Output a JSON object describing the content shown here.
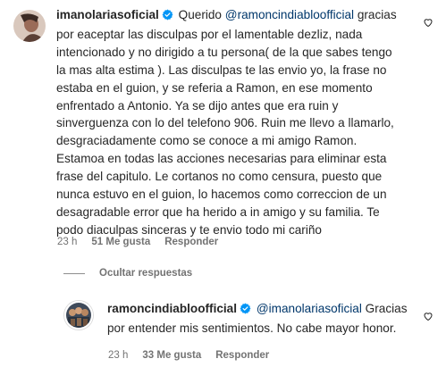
{
  "comments": [
    {
      "username": "imanolariasoficial",
      "mention": "@ramoncindiabloofficial",
      "lines": [
        "gracias",
        "por eaceptar las disculpas por el lamentable dezliz, nada",
        "intencionado y no dirigido a tu persona( de la que sabes tengo",
        "la mas alta estima ). Las disculpas te las envio yo, la frase no",
        "estaba en el guion, y se referia a Ramon, en ese momento",
        "enfrentado a Antonio. Ya se dijo antes que era ruin y",
        "sinverguenza con lo del telefono 906. Ruin me llevo a llamarlo,",
        "desgraciadamente como se conoce a mi amigo Ramon.",
        "Estamoa en todas las acciones necesarias para eliminar esta",
        "frase del capitulo. Le cortanos no como censura, puesto que",
        "nunca estuvo en el guion, lo hacemos como correccion de un",
        "desagradable error que ha herido a in amigo y su familia. Te",
        "podo diaculpas sinceras y te envio todo mi cariño"
      ],
      "first_word": "Querido",
      "time": "23 h",
      "likes": "51 Me gusta",
      "reply": "Responder"
    },
    {
      "username": "ramoncindiabloofficial",
      "mention": "@imanolariasoficial",
      "first_word": "",
      "lines_first_suffix": "Gracias",
      "line2": "por entender mis sentimientos. No cabe mayor honor.",
      "time": "23 h",
      "likes": "33 Me gusta",
      "reply": "Responder"
    }
  ],
  "hide_replies": "Ocultar respuestas",
  "icons": {
    "verified": "verified-badge-icon",
    "heart": "heart-outline-icon"
  },
  "colors": {
    "text": "#262626",
    "secondary": "#737373",
    "mention": "#00376b",
    "verified": "#0095f6"
  }
}
